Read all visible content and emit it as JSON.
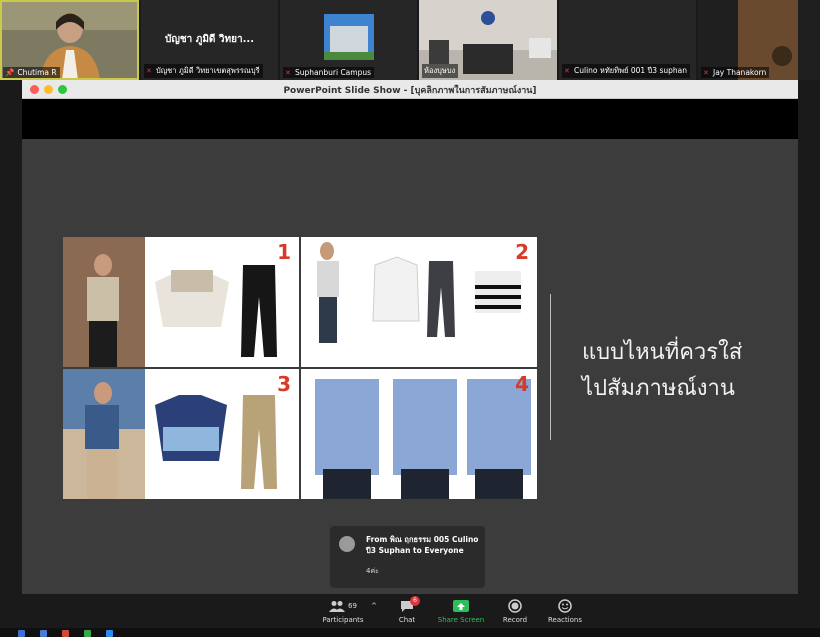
{
  "gallery": [
    {
      "name": "Chutima R",
      "muted": false,
      "active": true
    },
    {
      "name": "บัญชา ภูมิดี วิทยาเขตสุพรรณบุรี",
      "display": "บัญชา ภูมิดี วิทยา...",
      "muted": true
    },
    {
      "name": "Suphanburi Campus",
      "muted": true
    },
    {
      "name": "ห้องบุษบง",
      "muted": true
    },
    {
      "name": "Culino หทัยทิพย์ 001 ปี3 suphan",
      "muted": true
    },
    {
      "name": "Jay Thanakorn",
      "muted": true
    }
  ],
  "window": {
    "title": "PowerPoint Slide Show - [บุคลิกภาพในการสัมภาษณ์งาน]"
  },
  "slide": {
    "panels": [
      "1",
      "2",
      "3",
      "4"
    ],
    "heading_line1": "แบบไหนที่ควรใส่",
    "heading_line2": "ไปสัมภาษณ์งาน"
  },
  "chat_popup": {
    "from": "From พิณ ฤกธรรม 005 Culino ปี3 Suphan to Everyone",
    "message": "4ค่ะ"
  },
  "toolbar": {
    "participants_label": "Participants",
    "participants_count": "69",
    "chat_label": "Chat",
    "chat_badge": "6",
    "share_label": "Share Screen",
    "record_label": "Record",
    "reactions_label": "Reactions"
  },
  "colors": {
    "share_green": "#2ebd5b",
    "badge_red": "#e0333a",
    "slide_number_red": "#d63a2a",
    "active_speaker": "#c9c94a"
  }
}
